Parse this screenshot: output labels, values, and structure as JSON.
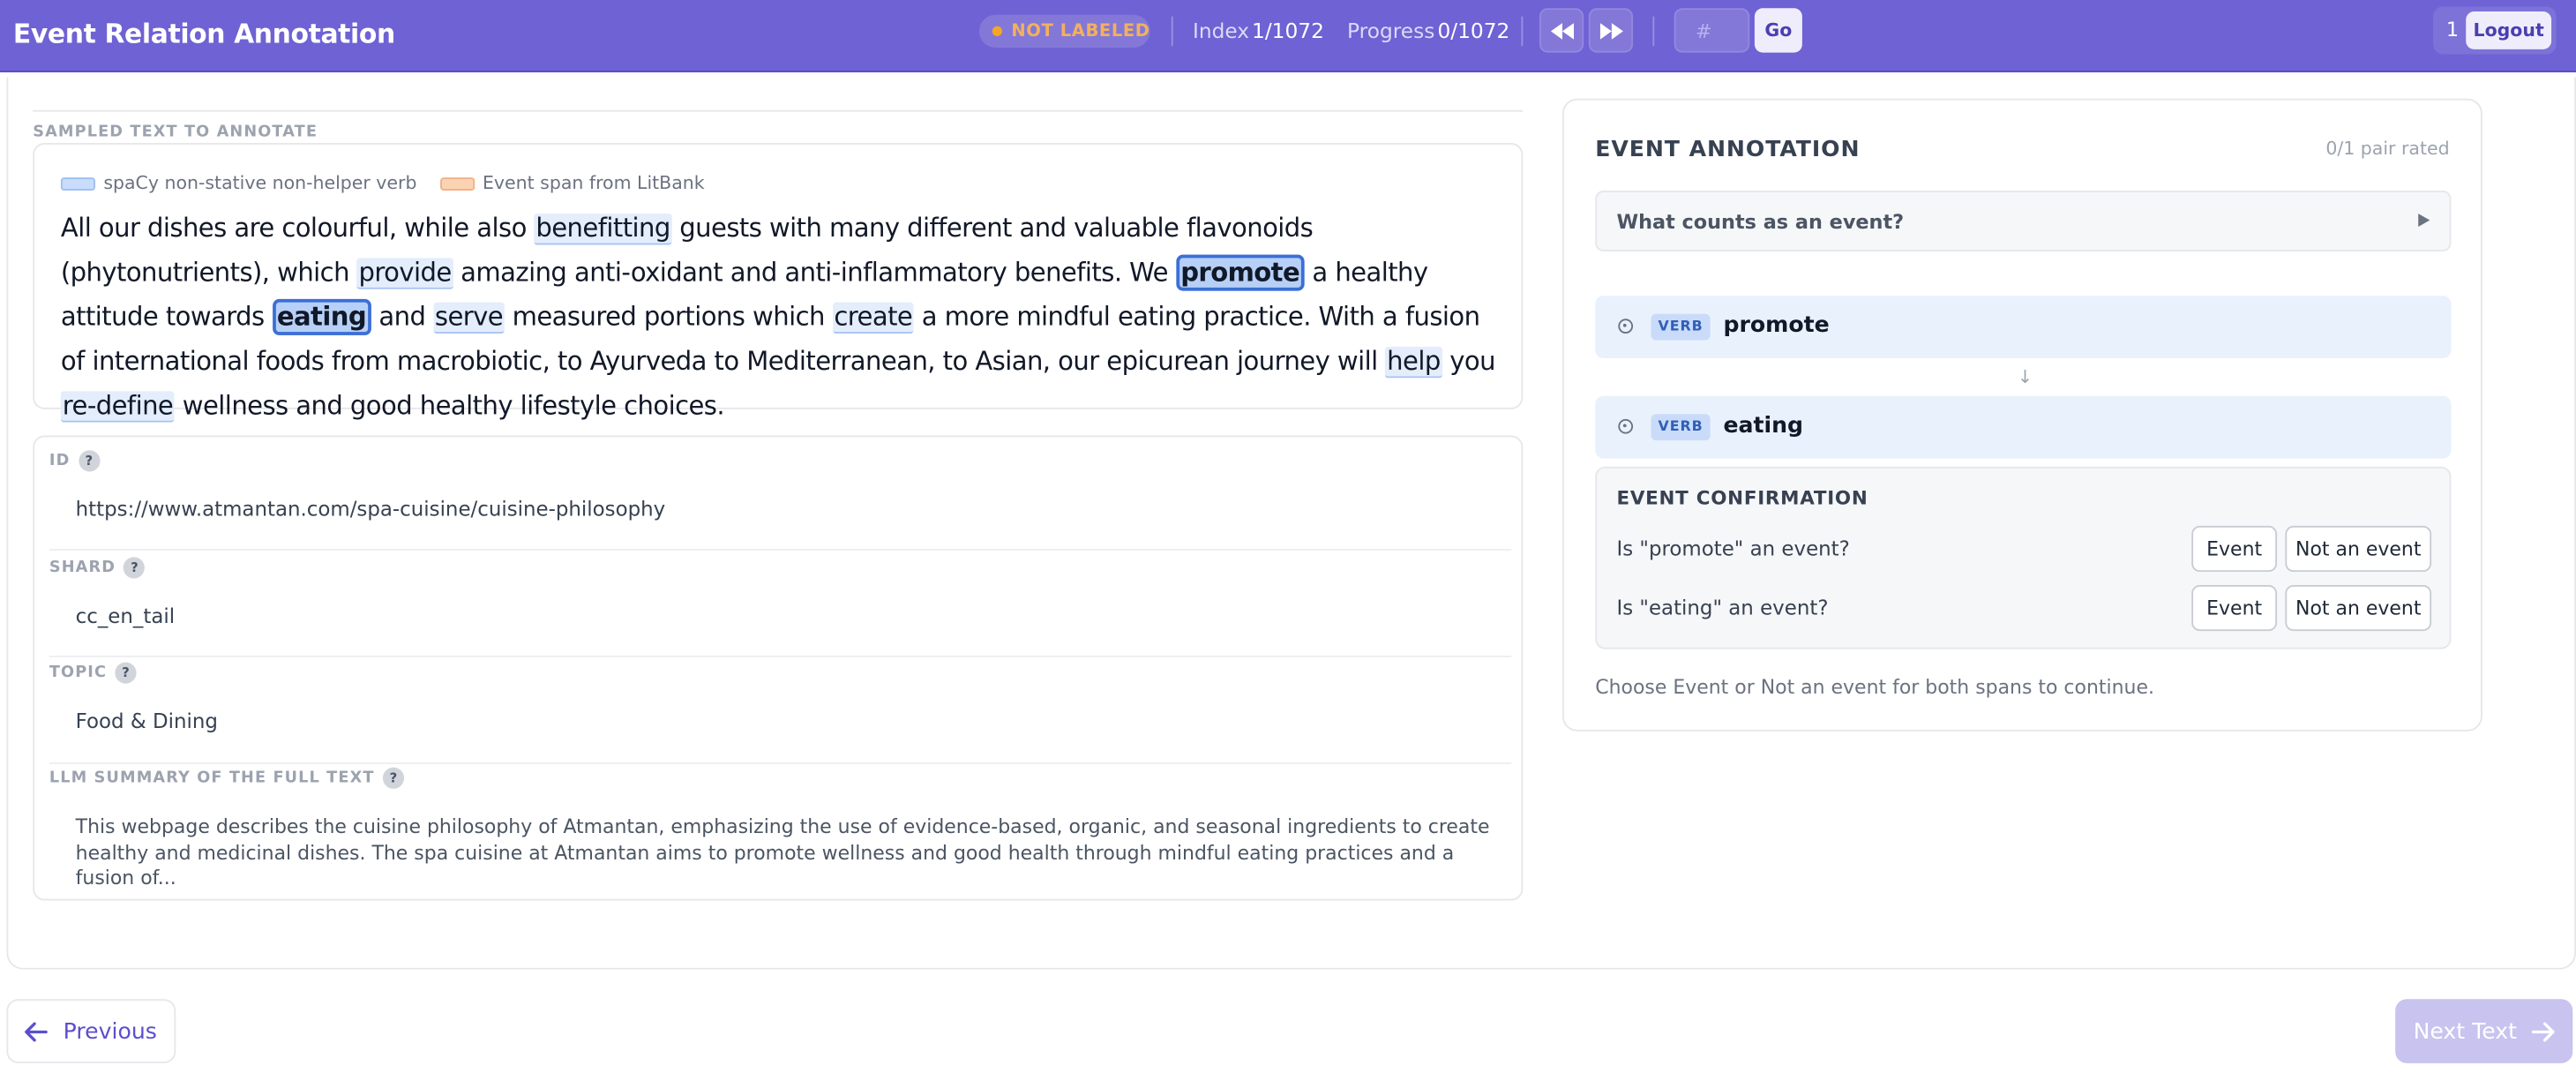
{
  "header": {
    "title": "Event Relation Annotation",
    "status": "NOT LABELED",
    "index_label": "Index",
    "index_value": "1/1072",
    "progress_label": "Progress",
    "progress_value": "0/1072",
    "jump_placeholder": "#",
    "go_label": "Go",
    "user_number": "1",
    "logout_label": "Logout"
  },
  "sample": {
    "section_label": "SAMPLED TEXT TO ANNOTATE",
    "legend": {
      "verb": "spaCy non-stative non-helper verb",
      "event": "Event span from LitBank"
    },
    "passage": [
      {
        "t": "All our dishes are colourful, while also "
      },
      {
        "t": "benefitting",
        "k": "verb"
      },
      {
        "t": " guests with many different and valuable flavonoids (phytonutrients), which "
      },
      {
        "t": "provide",
        "k": "verb"
      },
      {
        "t": " amazing anti-oxidant and anti-inflammatory benefits. We "
      },
      {
        "t": "promote",
        "k": "sel"
      },
      {
        "t": " a healthy attitude towards "
      },
      {
        "t": "eating",
        "k": "sel"
      },
      {
        "t": " and "
      },
      {
        "t": "serve",
        "k": "verb"
      },
      {
        "t": " measured portions which "
      },
      {
        "t": "create",
        "k": "verb"
      },
      {
        "t": " a more mindful eating practice. With a fusion of international foods from macrobiotic, to Ayurveda to Mediterranean, to Asian, our epicurean journey will "
      },
      {
        "t": "help",
        "k": "verb"
      },
      {
        "t": " you "
      },
      {
        "t": "re-define",
        "k": "verb"
      },
      {
        "t": " wellness and good healthy lifestyle choices."
      }
    ]
  },
  "meta": {
    "id_label": "ID",
    "id_value": "https://www.atmantan.com/spa-cuisine/cuisine-philosophy",
    "shard_label": "SHARD",
    "shard_value": "cc_en_tail",
    "topic_label": "TOPIC",
    "topic_value": "Food & Dining",
    "summary_label": "LLM SUMMARY OF THE FULL TEXT",
    "summary_value": "This webpage describes the cuisine philosophy of Atmantan, emphasizing the use of evidence-based, organic, and seasonal ingredients to create healthy and medicinal dishes. The spa cuisine at Atmantan aims to promote wellness and good health through mindful eating practices and a fusion of..."
  },
  "panel": {
    "title": "EVENT ANNOTATION",
    "pair_count": "0/1 pair rated",
    "info_label": "What counts as an event?",
    "span1": {
      "tag": "VERB",
      "word": "promote"
    },
    "span2": {
      "tag": "VERB",
      "word": "eating"
    },
    "confirm_title": "EVENT CONFIRMATION",
    "q1": "Is \"promote\" an event?",
    "q2": "Is \"eating\" an event?",
    "event_label": "Event",
    "not_event_label": "Not an event",
    "hint": "Choose Event or Not an event for both spans to continue."
  },
  "footer": {
    "prev_label": "Previous",
    "next_label": "Next Text"
  },
  "colors": {
    "header_bg": "#6e62d4",
    "accent": "#5b4fcf",
    "status_dot": "#f5a623",
    "verb_highlight": "#e3edfc",
    "selected_span_border": "#3b6fd6",
    "next_disabled": "#c8c3ef"
  },
  "icons": {
    "rewind": "rewind-icon",
    "fast_forward": "fast-forward-icon",
    "help": "help-icon",
    "play": "play-icon",
    "target": "target-icon",
    "arrow_down": "arrow-down-icon",
    "arrow_left": "arrow-left-icon",
    "arrow_right": "arrow-right-icon"
  }
}
